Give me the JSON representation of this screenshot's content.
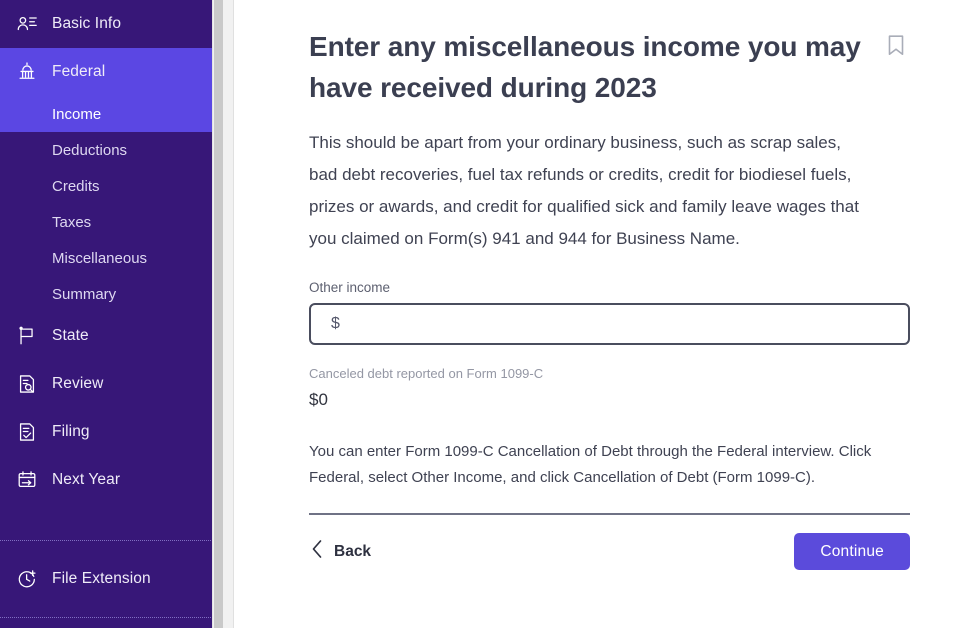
{
  "sidebar": {
    "accent_active": "#5B47E3",
    "background": "#371778",
    "items": [
      {
        "label": "Basic Info",
        "icon": "user-card-icon"
      },
      {
        "label": "Federal",
        "icon": "capitol-building-icon"
      },
      {
        "label": "State",
        "icon": "flag-icon"
      },
      {
        "label": "Review",
        "icon": "document-search-icon"
      },
      {
        "label": "Filing",
        "icon": "document-check-icon"
      },
      {
        "label": "Next Year",
        "icon": "calendar-arrow-icon"
      }
    ],
    "federal_subitems": [
      {
        "label": "Income",
        "active": true
      },
      {
        "label": "Deductions",
        "active": false
      },
      {
        "label": "Credits",
        "active": false
      },
      {
        "label": "Taxes",
        "active": false
      },
      {
        "label": "Miscellaneous",
        "active": false
      },
      {
        "label": "Summary",
        "active": false
      }
    ],
    "footer_items": [
      {
        "label": "File Extension",
        "icon": "clock-plus-icon"
      }
    ]
  },
  "main": {
    "title": "Enter any miscellaneous income you may have received during 2023",
    "bookmark_icon": "bookmark-icon",
    "description": "This should be apart from your ordinary business, such as scrap sales, bad debt recoveries, fuel tax refunds or credits, credit for biodiesel fuels, prizes or awards, and credit for qualified sick and family leave wages that you claimed on Form(s) 941 and 944 for Business Name.",
    "other_income": {
      "label": "Other income",
      "placeholder": "$",
      "value": ""
    },
    "canceled_debt": {
      "label": "Canceled debt reported on Form 1099-C",
      "value": "$0"
    },
    "note": "You can enter Form 1099-C Cancellation of Debt through the Federal interview. Click Federal, select Other Income, and click Cancellation of Debt (Form 1099-C).",
    "back_label": "Back",
    "continue_label": "Continue",
    "continue_color": "#5B4BDB"
  }
}
